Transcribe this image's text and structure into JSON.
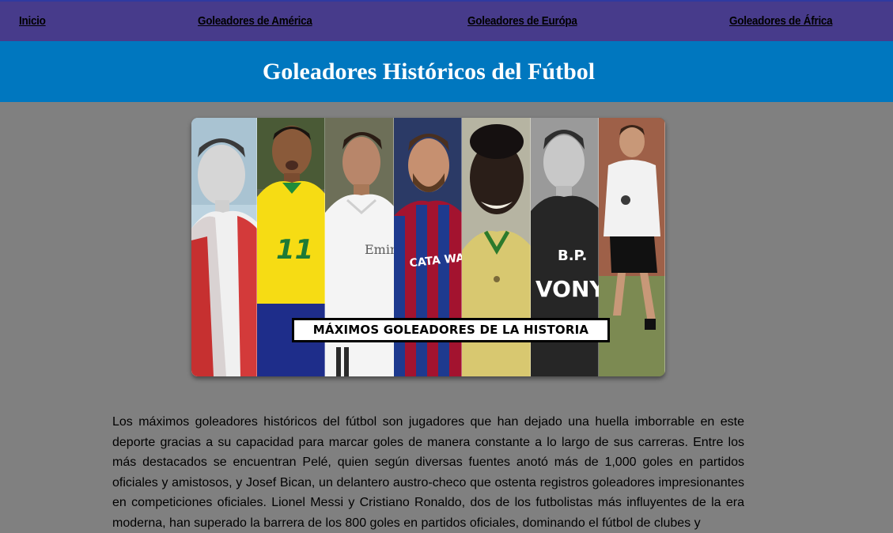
{
  "nav": {
    "items": [
      {
        "label": "Inicio"
      },
      {
        "label": "Goleadores de América"
      },
      {
        "label": "Goleadores de Európa"
      },
      {
        "label": "Goleadores de África"
      }
    ]
  },
  "hero": {
    "title": "Goleadores Históricos del Fútbol"
  },
  "banner": {
    "caption": "MÁXIMOS GOLEADORES DE LA HISTORIA",
    "panel_jersey_texts": [
      "11",
      "Emir",
      "CATA WAY",
      "B.P. VONYV"
    ],
    "colors": {
      "frame": "#ffffff",
      "caption_border": "#000000"
    }
  },
  "article": {
    "text": "Los máximos goleadores históricos del fútbol son jugadores que han dejado una huella imborrable en este deporte gracias a su capacidad para marcar goles de manera constante a lo largo de sus carreras. Entre los más destacados se encuentran Pelé, quien según diversas fuentes anotó más de 1,000 goles en partidos oficiales y amistosos, y Josef Bican, un delantero austro-checo que ostenta registros goleadores impresionantes en competiciones oficiales. Lionel Messi y Cristiano Ronaldo, dos de los futbolistas más influyentes de la era moderna, han superado la barrera de los 800 goles en partidos oficiales, dominando el fútbol de clubes y"
  },
  "theme": {
    "page_bg": "#808080",
    "nav_bg": "#473b8b",
    "hero_bg": "#0077bf",
    "link_color": "#000000",
    "title_color": "#ffffff"
  }
}
